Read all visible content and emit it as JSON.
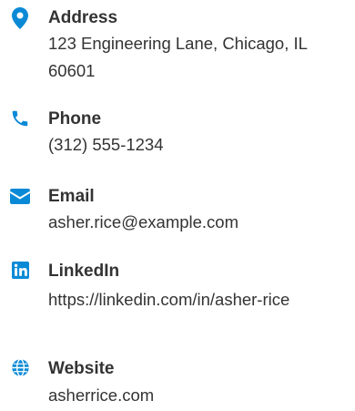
{
  "contact": {
    "accent_color": "#0a8ad6",
    "items": [
      {
        "icon": "map-pin-icon",
        "label": "Address",
        "value": "123 Engineering Lane, Chicago, IL 60601"
      },
      {
        "icon": "phone-icon",
        "label": "Phone",
        "value": "(312) 555-1234"
      },
      {
        "icon": "envelope-icon",
        "label": "Email",
        "value": "asher.rice@example.com"
      },
      {
        "icon": "linkedin-icon",
        "label": "LinkedIn",
        "value": "https://linkedin.com/in/asher-rice"
      },
      {
        "icon": "globe-icon",
        "label": "Website",
        "value": "asherrice.com"
      }
    ]
  }
}
